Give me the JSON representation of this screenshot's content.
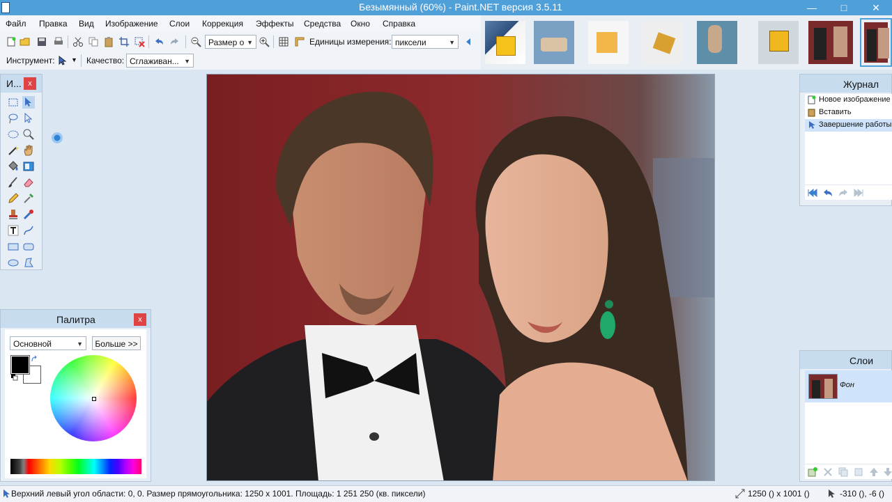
{
  "window": {
    "title": "Безымянный (60%) - Paint.NET версия 3.5.11",
    "controls": {
      "minimize": "—",
      "maximize": "□",
      "close": "✕"
    }
  },
  "menu": [
    "Файл",
    "Правка",
    "Вид",
    "Изображение",
    "Слои",
    "Коррекция",
    "Эффекты",
    "Средства",
    "Окно",
    "Справка"
  ],
  "toolbar": {
    "zoom_value": "Размер о",
    "units_label": "Единицы измерения:",
    "units_value": "пиксели",
    "tool_label": "Инструмент:",
    "quality_label": "Качество:",
    "quality_value": "Сглаживан..."
  },
  "tools_panel": {
    "title": "И...",
    "close": "x"
  },
  "history_panel": {
    "title": "Журнал",
    "items": [
      "Новое изображение",
      "Вставить",
      "Завершение работы с"
    ]
  },
  "palette_panel": {
    "title": "Палитра",
    "close": "x",
    "mode_value": "Основной",
    "more_button": "Больше >>",
    "primary_color": "#000000",
    "secondary_color": "#ffffff"
  },
  "layers_panel": {
    "title": "Слои",
    "layers": [
      {
        "name": "Фон"
      }
    ]
  },
  "status": {
    "selection_info": "Верхний левый угол области: 0, 0. Размер прямоугольника: 1250 x 1001. Площадь: 1 251 250 (кв. пиксели)",
    "image_size": "1250 () x 1001 ()",
    "cursor_pos": "-310 (), -6 ()"
  },
  "colors": {
    "accent": "#4f9fd8",
    "panel_bg": "#e7eef6",
    "panel_title_bg": "#c8dcf0"
  }
}
